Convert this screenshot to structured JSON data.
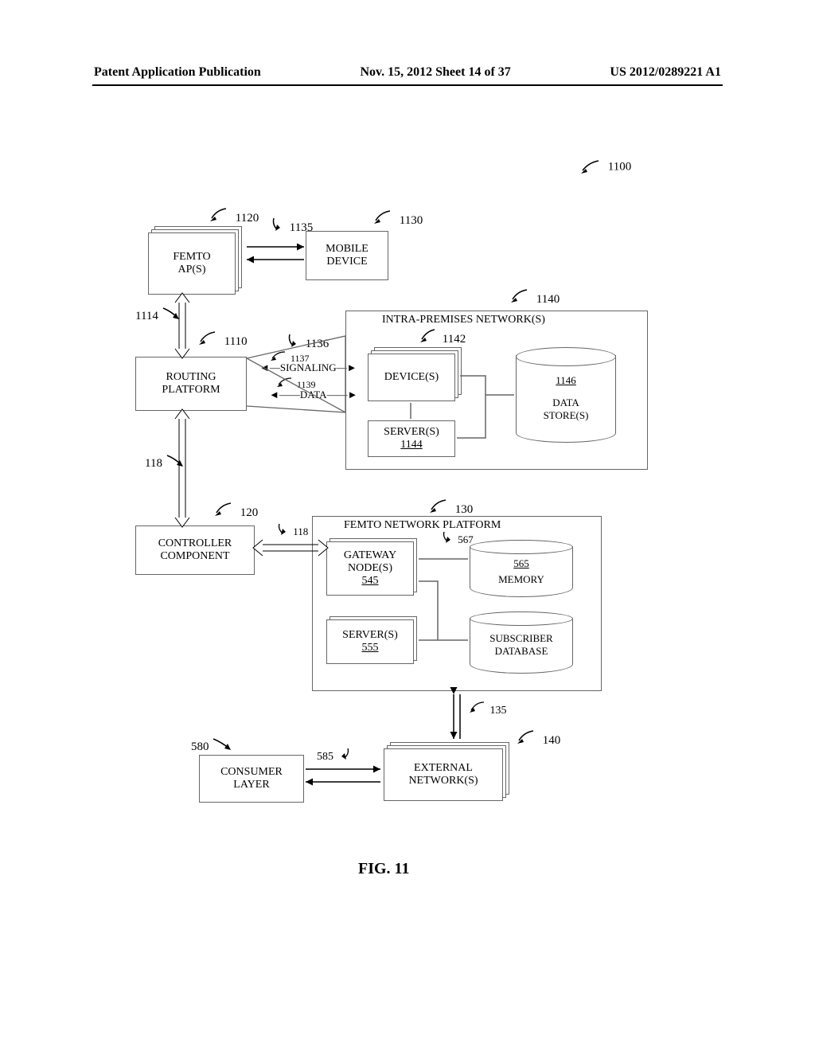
{
  "header": {
    "left": "Patent Application Publication",
    "center": "Nov. 15, 2012  Sheet 14 of 37",
    "right": "US 2012/0289221 A1"
  },
  "refs": {
    "top_figure": "1100",
    "femto_aps": "1120",
    "mobile_device": "1130",
    "link_femto_mobile": "1135",
    "link_femto_routing": "1114",
    "routing_platform": "1110",
    "signaling_link": "1136",
    "signaling_arrow": "1137",
    "data_arrow": "1139",
    "intra_premises": "1140",
    "devices": "1142",
    "servers_intra": "1144",
    "data_stores": "1146",
    "link_routing_controller": "118",
    "controller": "120",
    "link_controller_fnp": "118",
    "fnp": "130",
    "gateway": "545",
    "servers_fnp": "555",
    "memory": "565",
    "cyl_link": "567",
    "subscriber_db": "",
    "link_fnp_ext": "135",
    "external": "140",
    "consumer": "580",
    "link_consumer_ext": "585"
  },
  "boxes": {
    "femto_aps": "FEMTO\nAP(S)",
    "mobile_device": "MOBILE\nDEVICE",
    "routing_platform": "ROUTING\nPLATFORM",
    "intra_premises_title": "INTRA-PREMISES NETWORK(S)",
    "devices": "DEVICE(S)",
    "servers_intra": "SERVER(S)",
    "data_stores": "DATA\nSTORE(S)",
    "controller": "CONTROLLER\nCOMPONENT",
    "fnp_title": "FEMTO NETWORK PLATFORM",
    "gateway": "GATEWAY\nNODE(S)",
    "servers_fnp": "SERVER(S)",
    "memory": "MEMORY",
    "subscriber_db": "SUBSCRIBER\nDATABASE",
    "consumer": "CONSUMER\nLAYER",
    "external": "EXTERNAL\nNETWORK(S)"
  },
  "arrow_labels": {
    "signaling": "SIGNALING",
    "data": "DATA"
  },
  "figure_label": "FIG. 11"
}
